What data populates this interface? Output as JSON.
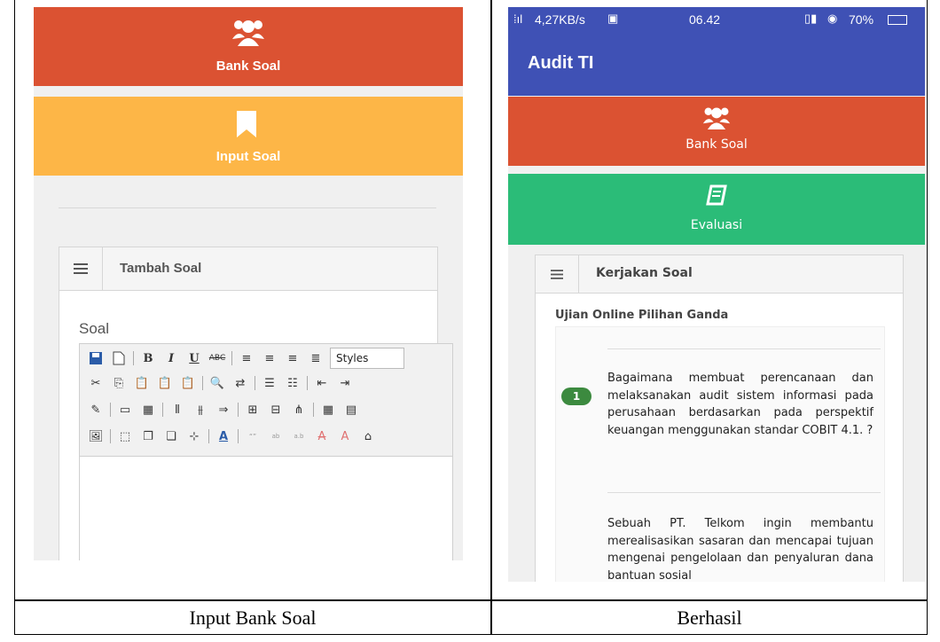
{
  "left_panel": {
    "tile_bank_soal": "Bank Soal",
    "tile_input_soal": "Input Soal",
    "card_title": "Tambah Soal",
    "soal_label": "Soal",
    "styles_select": "Styles"
  },
  "right_panel": {
    "status_left": "4,27KB/s",
    "status_time": "06.42",
    "status_battery": "70%",
    "app_title": "Audit TI",
    "tile_bank_soal": "Bank Soal",
    "tile_evaluasi": "Evaluasi",
    "card_title": "Kerjakan Soal",
    "exam_title": "Ujian Online Pilihan Ganda",
    "question_number": "1",
    "question_1": "Bagaimana membuat perencanaan dan melaksanakan audit sistem informasi pada perusahaan berdasarkan pada perspektif keuangan menggunakan standar COBIT 4.1. ?",
    "question_2": "Sebuah PT. Telkom ingin membantu merealisasikan sasaran dan mencapai tujuan mengenai pengelolaan dan penyaluran dana bantuan sosial"
  },
  "captions": {
    "left": "Input Bank Soal",
    "right": "Berhasil"
  },
  "colors": {
    "red_tile": "#db5232",
    "yellow_tile": "#fdb647",
    "green_tile": "#2bbc78",
    "app_bar": "#3f51b5",
    "badge": "#3c8a3f"
  }
}
